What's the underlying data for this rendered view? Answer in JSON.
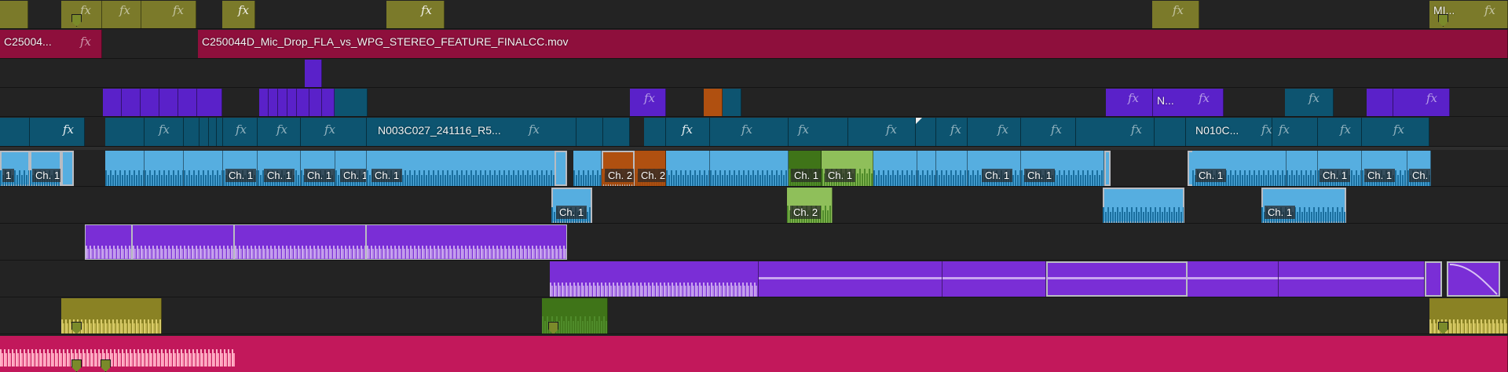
{
  "colors": {
    "track_bg": "#232323",
    "olive": "#7b7a2a",
    "olive_dark": "#5c5c20",
    "crimson": "#8e0f3c",
    "indigo": "#5a21c9",
    "teal": "#0d5470",
    "teal_audio": "#56aee0",
    "rust": "#b05010",
    "green": "#3f7418",
    "green_audio": "#8fbf5a",
    "purple_audio": "#7a2ed6",
    "purple_wave": "#c9a5ef",
    "yellow_audio": "#8a8224",
    "pink_audio": "#f06a95"
  },
  "clip_labels": {
    "c250_short": "C25004...",
    "c250_long": "C250044D_Mic_Drop_FLA_vs_WPG_STEREO_FEATURE_FINALCC.mov",
    "n_short": "N...",
    "n003": "N003C027_241116_R5...",
    "n010": "N010C...",
    "mi": "MI...",
    "ch1": "Ch. 1",
    "ch2": "Ch. 2",
    "one": "1"
  },
  "fx_glyph": "fx",
  "icons": {
    "marker": "marker-icon",
    "fx": "fx-badge-icon",
    "keyframe_corner": "corner-triangle-icon"
  }
}
